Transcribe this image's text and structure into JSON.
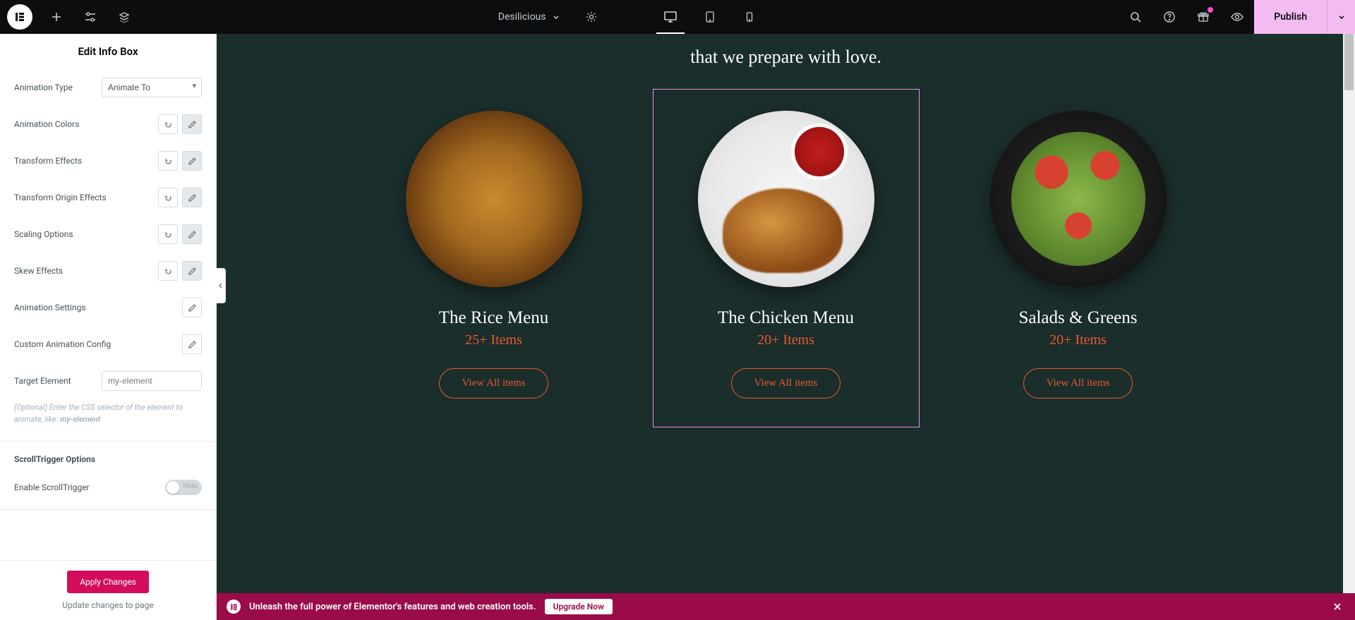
{
  "topbar": {
    "page_name": "Desilicious",
    "publish_label": "Publish"
  },
  "sidebar": {
    "title": "Edit Info Box",
    "controls": {
      "animation_type_label": "Animation Type",
      "animation_type_value": "Animate To",
      "animation_colors": "Animation Colors",
      "transform_effects": "Transform Effects",
      "transform_origin_effects": "Transform Origin Effects",
      "scaling_options": "Scaling Options",
      "skew_effects": "Skew Effects",
      "animation_settings": "Animation Settings",
      "custom_animation_config": "Custom Animation Config",
      "target_element_label": "Target Element",
      "target_element_placeholder": "my-element",
      "target_help_prefix": "(Optional) Enter the CSS selector of the element to animate, like: ",
      "target_help_bold": "my-element",
      "scrolltrigger_section": "ScrollTrigger Options",
      "enable_scrolltrigger": "Enable ScrollTrigger",
      "toggle_state_label": "Hide"
    },
    "footer": {
      "apply_label": "Apply Changes",
      "update_text": "Update changes to page"
    }
  },
  "canvas": {
    "tagline": "that we prepare with love.",
    "cards": [
      {
        "title": "The Rice Menu",
        "subtitle": "25+ Items",
        "button": "View All items"
      },
      {
        "title": "The Chicken Menu",
        "subtitle": "20+ Items",
        "button": "View All items"
      },
      {
        "title": "Salads & Greens",
        "subtitle": "20+ Items",
        "button": "View All items"
      }
    ]
  },
  "banner": {
    "text": "Unleash the full power of Elementor's features and web creation tools.",
    "cta": "Upgrade Now"
  }
}
